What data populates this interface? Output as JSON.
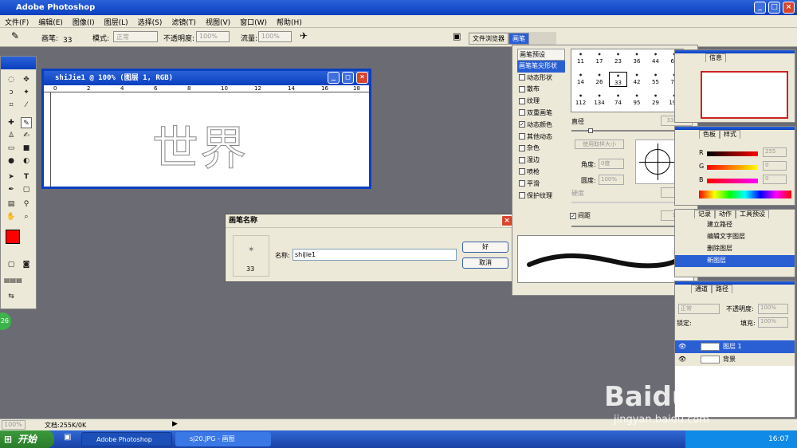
{
  "app": {
    "title": "Adobe Photoshop"
  },
  "menu": [
    "文件(F)",
    "编辑(E)",
    "图像(I)",
    "图层(L)",
    "选择(S)",
    "滤镜(T)",
    "视图(V)",
    "窗口(W)",
    "帮助(H)"
  ],
  "options": {
    "brush_label": "画笔:",
    "brush_size": "33",
    "mode_label": "模式:",
    "mode_value": "正常",
    "opacity_label": "不透明度:",
    "opacity_value": "100%",
    "flow_label": "流量:",
    "flow_value": "100%"
  },
  "well_tabs": [
    "文件浏览器",
    "画笔"
  ],
  "document": {
    "title": "shiJie1 @ 100% (图层 1, RGB)",
    "ruler": [
      "0",
      "2",
      "4",
      "6",
      "8",
      "10",
      "12",
      "14",
      "16",
      "18"
    ],
    "canvas_text": "世界"
  },
  "dialog": {
    "title": "画笔名称",
    "preview_size": "33",
    "name_label": "名称:",
    "name_value": "shiJie1",
    "ok": "好",
    "cancel": "取消"
  },
  "brush_panel": {
    "options": [
      {
        "label": "画笔预设",
        "check": false,
        "header": true
      },
      {
        "label": "画笔笔尖形状",
        "check": false,
        "selected": true,
        "header": true
      },
      {
        "label": "动态形状",
        "check": true,
        "checked": false
      },
      {
        "label": "散布",
        "check": true,
        "checked": false
      },
      {
        "label": "纹理",
        "check": true,
        "checked": false
      },
      {
        "label": "双重画笔",
        "check": true,
        "checked": false
      },
      {
        "label": "动态颜色",
        "check": true,
        "checked": true
      },
      {
        "label": "其他动态",
        "check": true,
        "checked": false
      },
      {
        "label": "杂色",
        "check": true,
        "checked": false
      },
      {
        "label": "湿边",
        "check": true,
        "checked": false
      },
      {
        "label": "喷枪",
        "check": true,
        "checked": false
      },
      {
        "label": "平滑",
        "check": true,
        "checked": false
      },
      {
        "label": "保护纹理",
        "check": true,
        "checked": false
      }
    ],
    "presets": [
      "11",
      "17",
      "23",
      "36",
      "44",
      "60",
      "14",
      "26",
      "33",
      "42",
      "55",
      "70",
      "112",
      "134",
      "74",
      "95",
      "29",
      "192"
    ],
    "diameter_label": "直径",
    "diameter_value": "33 像素",
    "use_sample": "使用取样大小",
    "angle_label": "角度:",
    "angle_value": "0度",
    "roundness_label": "圆度:",
    "roundness_value": "100%",
    "hardness_label": "硬度",
    "spacing_label": "间距",
    "spacing_value": "1%"
  },
  "history_panel": {
    "tabs": [
      "记录",
      "动作",
      "工具预设"
    ],
    "items": [
      "建立路径",
      "编辑文字图层",
      "删除图层",
      "新图层"
    ]
  },
  "nav_panel": {
    "tabs": [
      "信息"
    ]
  },
  "color_panel": {
    "tabs": [
      "色板",
      "样式"
    ],
    "values": [
      "255",
      "0",
      "0"
    ],
    "channels": [
      "R",
      "G",
      "B"
    ]
  },
  "layers_panel": {
    "tabs": [
      "通道",
      "路径"
    ],
    "mode": "正常",
    "opacity_label": "不透明度:",
    "opacity_value": "100%",
    "lock_label": "锁定:",
    "fill_label": "填充:",
    "fill_value": "100%",
    "layers": [
      {
        "name": "图层 1",
        "selected": true
      },
      {
        "name": "背景",
        "selected": false
      }
    ]
  },
  "status": {
    "zoom": "100%",
    "doc": "文档:255K/0K"
  },
  "taskbar": {
    "start": "开始",
    "tasks": [
      "Adobe Photoshop",
      "sj20.JPG - 画图"
    ],
    "time": "16:07"
  },
  "watermark": {
    "brand": "Baidu经验",
    "url": "jingyan.baidu.com"
  },
  "colors": {
    "foreground": "#ff0000",
    "background": "#0000cc",
    "accent": "#0a3fbf"
  }
}
